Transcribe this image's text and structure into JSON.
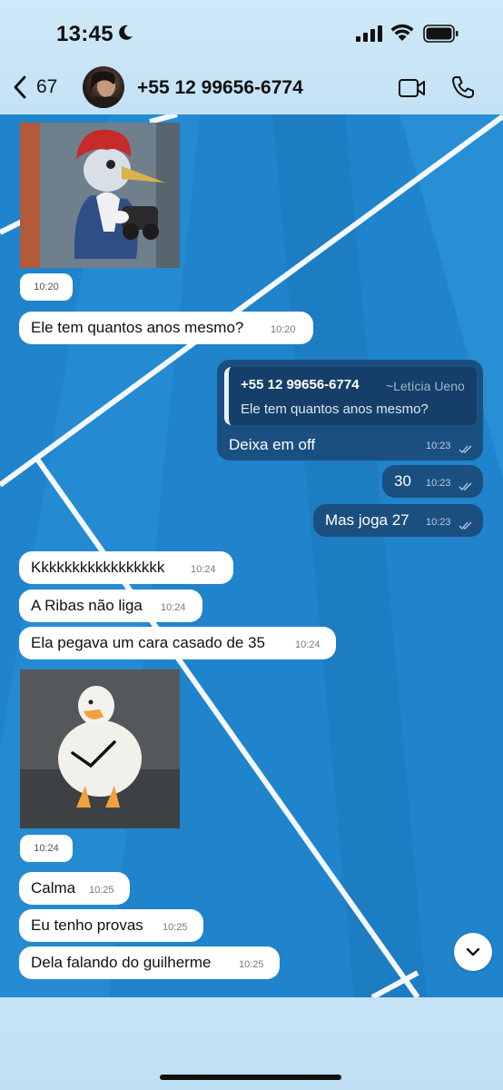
{
  "status_bar": {
    "time": "13:45"
  },
  "header": {
    "back_count": "67",
    "contact_name": "+55 12 99656-6774"
  },
  "messages": {
    "m1": {
      "time": "10:20"
    },
    "m2": {
      "text": "Ele tem quantos anos mesmo?",
      "time": "10:20"
    },
    "m3": {
      "reply_sender": "+55 12 99656-6774",
      "reply_alias": "~Letícia Ueno",
      "reply_quote": "Ele tem quantos anos mesmo?",
      "text": "Deixa em off",
      "time": "10:23"
    },
    "m4": {
      "text": "30",
      "time": "10:23"
    },
    "m5": {
      "text": "Mas joga 27",
      "time": "10:23"
    },
    "m6": {
      "text": "Kkkkkkkkkkkkkkkkk",
      "time": "10:24"
    },
    "m7": {
      "text": "A Ribas não liga",
      "time": "10:24"
    },
    "m8": {
      "text": "Ela pegava um cara casado de 35",
      "time": "10:24"
    },
    "m9": {
      "time": "10:24"
    },
    "m10": {
      "text": "Calma",
      "time": "10:25"
    },
    "m11": {
      "text": "Eu tenho provas",
      "time": "10:25"
    },
    "m12": {
      "text": "Dela falando do guilherme",
      "time": "10:25"
    }
  },
  "icons": {
    "back": "chevron-left-icon",
    "video": "video-camera-icon",
    "call": "phone-icon",
    "scroll": "chevron-down-icon",
    "read": "double-check-icon"
  },
  "colors": {
    "incoming_bubble": "#ffffff",
    "outgoing_bubble": "#1b4f80",
    "chat_background": "#1d7fc9"
  }
}
